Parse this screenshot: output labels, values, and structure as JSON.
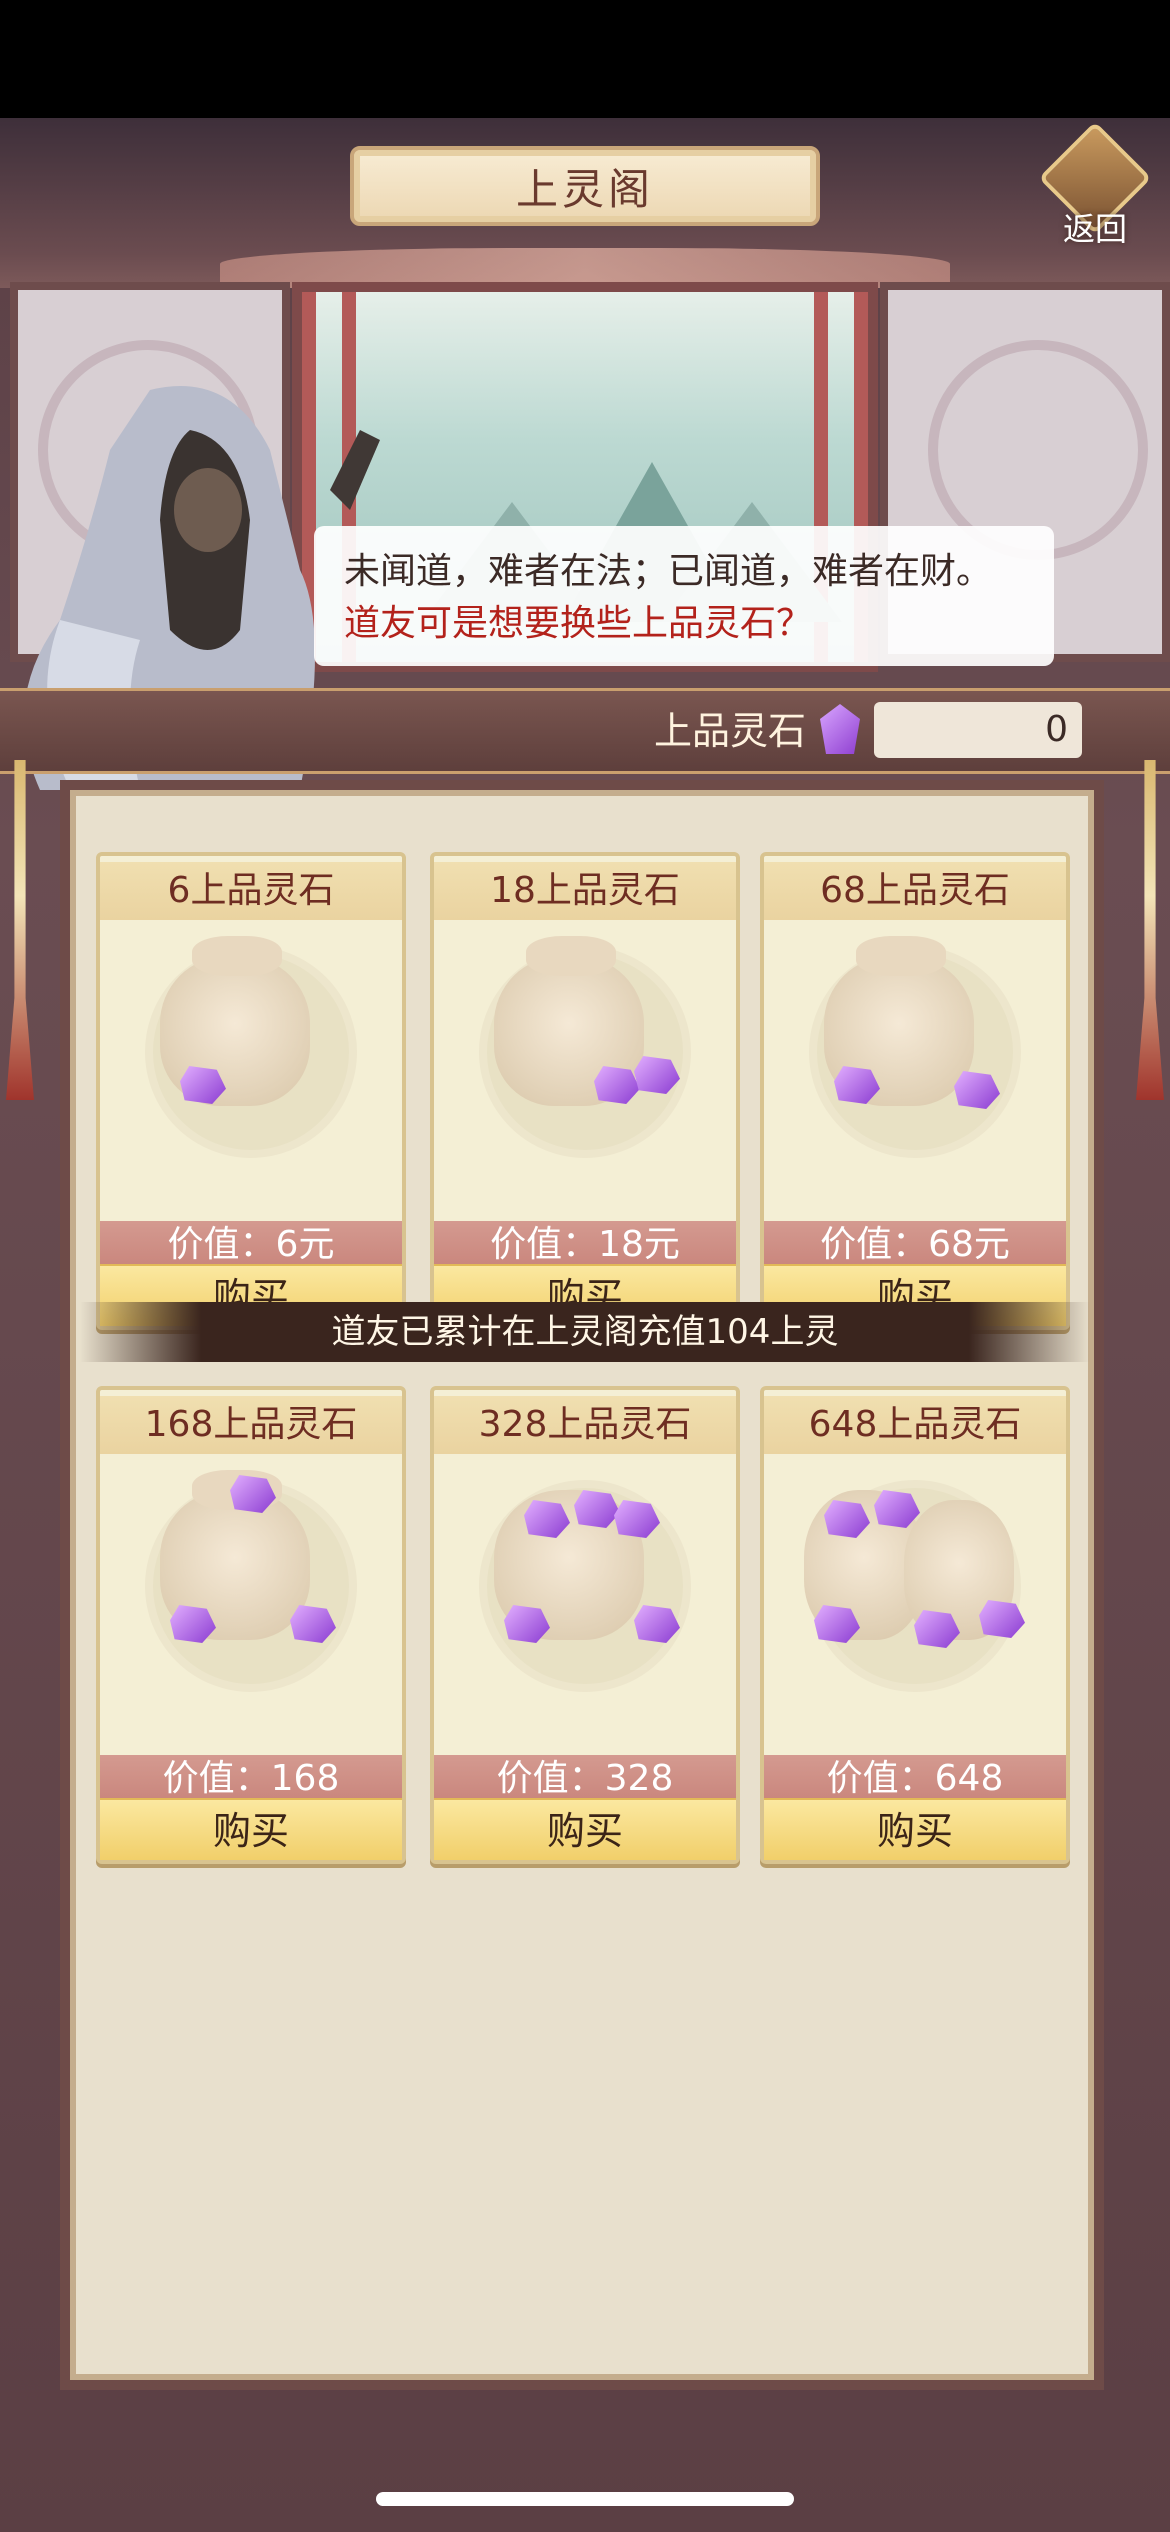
{
  "header": {
    "title": "上灵阁",
    "back_label": "返回"
  },
  "dialogue": {
    "line1": "未闻道，难者在法；已闻道，难者在财。",
    "line2": "道友可是想要换些上品灵石？"
  },
  "currency": {
    "label": "上品灵石",
    "amount": "0",
    "icon": "purple-gem-icon"
  },
  "banner": {
    "text": "道友已累计在上灵阁充值104上灵"
  },
  "products": [
    {
      "title": "6上品灵石",
      "value": "价值：6元",
      "buy": "购买"
    },
    {
      "title": "18上品灵石",
      "value": "价值：18元",
      "buy": "购买"
    },
    {
      "title": "68上品灵石",
      "value": "价值：68元",
      "buy": "购买"
    },
    {
      "title": "168上品灵石",
      "value": "价值：168",
      "buy": "购买"
    },
    {
      "title": "328上品灵石",
      "value": "价值：328",
      "buy": "购买"
    },
    {
      "title": "648上品灵石",
      "value": "价值：648",
      "buy": "购买"
    }
  ],
  "colors": {
    "title_red": "#6e2d22",
    "dialog_red": "#b3221b",
    "buy_gold": "#f1cf6a",
    "value_bar": "#c9857c"
  }
}
